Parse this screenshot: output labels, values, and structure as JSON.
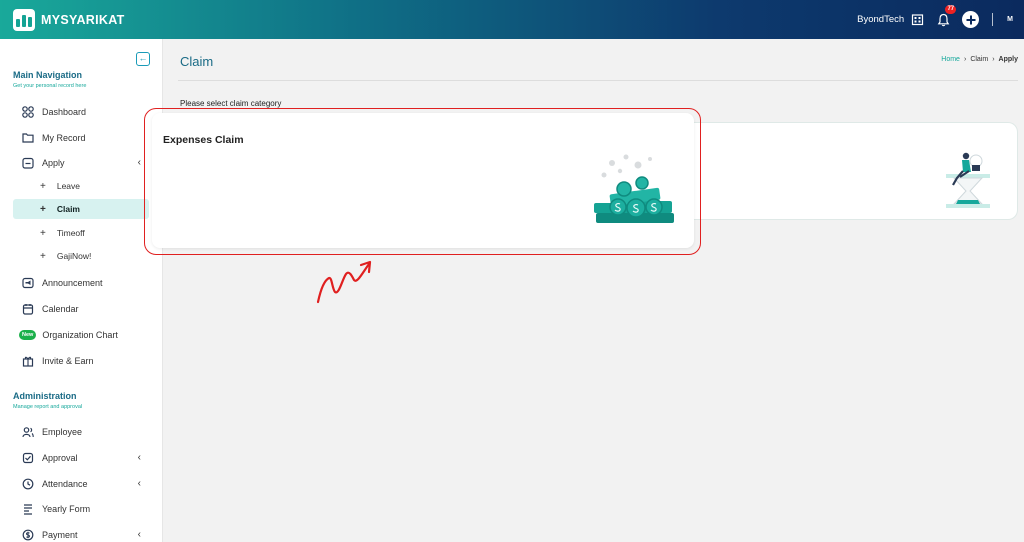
{
  "app": {
    "brand": "MYSYARIKAT",
    "company": "ByondTech",
    "notification_count": "77",
    "user_initials": "M"
  },
  "sidebar": {
    "main_nav": {
      "title": "Main Navigation",
      "subtitle": "Get your personal record here"
    },
    "items": [
      {
        "label": "Dashboard",
        "icon": "dashboard-grid-icon"
      },
      {
        "label": "My Record",
        "icon": "folder-icon"
      },
      {
        "label": "Apply",
        "icon": "apply-icon",
        "expanded": true
      },
      {
        "label": "Announcement",
        "icon": "announcement-icon"
      },
      {
        "label": "Calendar",
        "icon": "calendar-icon"
      },
      {
        "label": "Organization Chart",
        "icon": "org-chart-icon",
        "badge": "New"
      },
      {
        "label": "Invite & Earn",
        "icon": "gift-icon"
      }
    ],
    "apply_sub": [
      {
        "label": "Leave"
      },
      {
        "label": "Claim",
        "active": true
      },
      {
        "label": "Timeoff"
      },
      {
        "label": "GajiNow!"
      }
    ],
    "admin": {
      "title": "Administration",
      "subtitle": "Manage report and approval"
    },
    "admin_items": [
      {
        "label": "Employee",
        "icon": "employee-icon"
      },
      {
        "label": "Approval",
        "icon": "approval-icon"
      },
      {
        "label": "Attendance",
        "icon": "clock-icon"
      },
      {
        "label": "Yearly Form",
        "icon": "form-icon"
      },
      {
        "label": "Payment",
        "icon": "payment-icon"
      }
    ]
  },
  "page": {
    "title": "Claim",
    "breadcrumb": [
      "Home",
      "Claim",
      "Apply"
    ],
    "prompt": "Please select claim category",
    "cards": [
      {
        "title": "Expenses Claim",
        "illustration": "coin-stack-illustration"
      },
      {
        "title": "",
        "illustration": "person-hourglass-illustration"
      }
    ]
  },
  "colors": {
    "accent": "#16a89b",
    "title": "#1a6b86",
    "highlight": "#e02020",
    "active_bg": "#d7f2f0"
  }
}
